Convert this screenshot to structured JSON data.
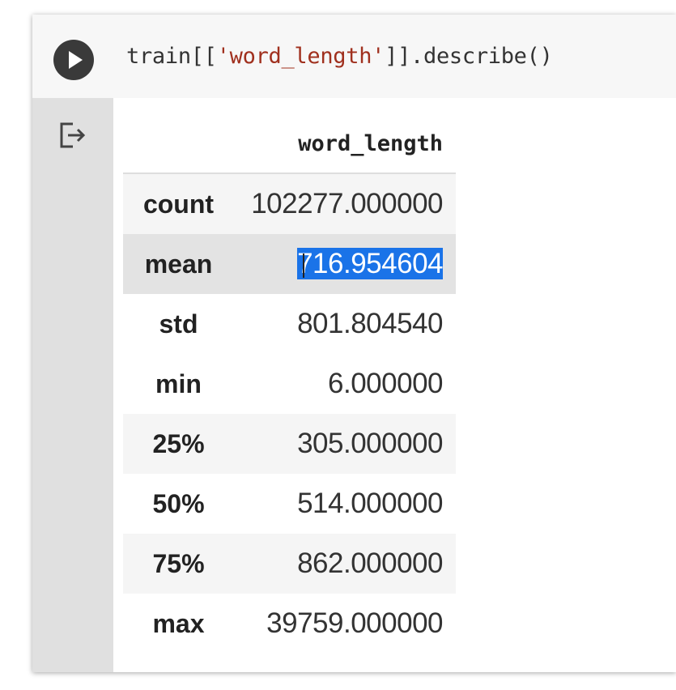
{
  "code_cell": {
    "code_prefix": "train[[",
    "code_string": "'word_length'",
    "code_suffix": "]].describe()"
  },
  "output": {
    "column_header": "word_length",
    "rows": [
      {
        "index": "count",
        "value": "102277.000000"
      },
      {
        "index": "mean",
        "value_first_char": "7",
        "value_rest": "16.954604"
      },
      {
        "index": "std",
        "value": "801.804540"
      },
      {
        "index": "min",
        "value": "6.000000"
      },
      {
        "index": "25%",
        "value": "305.000000"
      },
      {
        "index": "50%",
        "value": "514.000000"
      },
      {
        "index": "75%",
        "value": "862.000000"
      },
      {
        "index": "max",
        "value": "39759.000000"
      }
    ],
    "selection_color": "#1a73e8"
  }
}
